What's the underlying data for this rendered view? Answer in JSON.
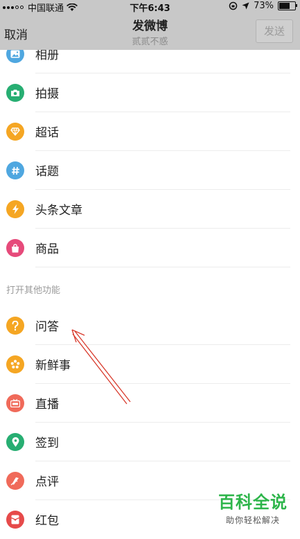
{
  "status_bar": {
    "carrier": "中国联通",
    "time": "下午6:43",
    "battery_text": "73%",
    "battery_level": 0.73
  },
  "nav": {
    "cancel_label": "取消",
    "title": "发微博",
    "subtitle": "贰贰不惑",
    "send_label": "发送"
  },
  "menu_top": [
    {
      "label": "相册",
      "icon": "photo-icon",
      "color": "#4fa7e0"
    },
    {
      "label": "拍摄",
      "icon": "camera-icon",
      "color": "#27ae72"
    },
    {
      "label": "超话",
      "icon": "diamond-icon",
      "color": "#f5a623"
    },
    {
      "label": "话题",
      "icon": "hashtag-icon",
      "color": "#4fa7e0"
    },
    {
      "label": "头条文章",
      "icon": "lightning-icon",
      "color": "#f5a623"
    },
    {
      "label": "商品",
      "icon": "shopping-bag-icon",
      "color": "#e64a7a"
    }
  ],
  "section_label": "打开其他功能",
  "menu_bottom": [
    {
      "label": "问答",
      "icon": "question-icon",
      "color": "#f5a623"
    },
    {
      "label": "新鲜事",
      "icon": "flower-icon",
      "color": "#f5a623"
    },
    {
      "label": "直播",
      "icon": "live-icon",
      "color": "#f06a5a"
    },
    {
      "label": "签到",
      "icon": "location-pin-icon",
      "color": "#27ae72"
    },
    {
      "label": "点评",
      "icon": "review-icon",
      "color": "#f06a5a"
    },
    {
      "label": "红包",
      "icon": "red-envelope-icon",
      "color": "#e64a4a"
    }
  ],
  "watermark": {
    "title": "百科全说",
    "subtitle": "助你轻松解决"
  }
}
